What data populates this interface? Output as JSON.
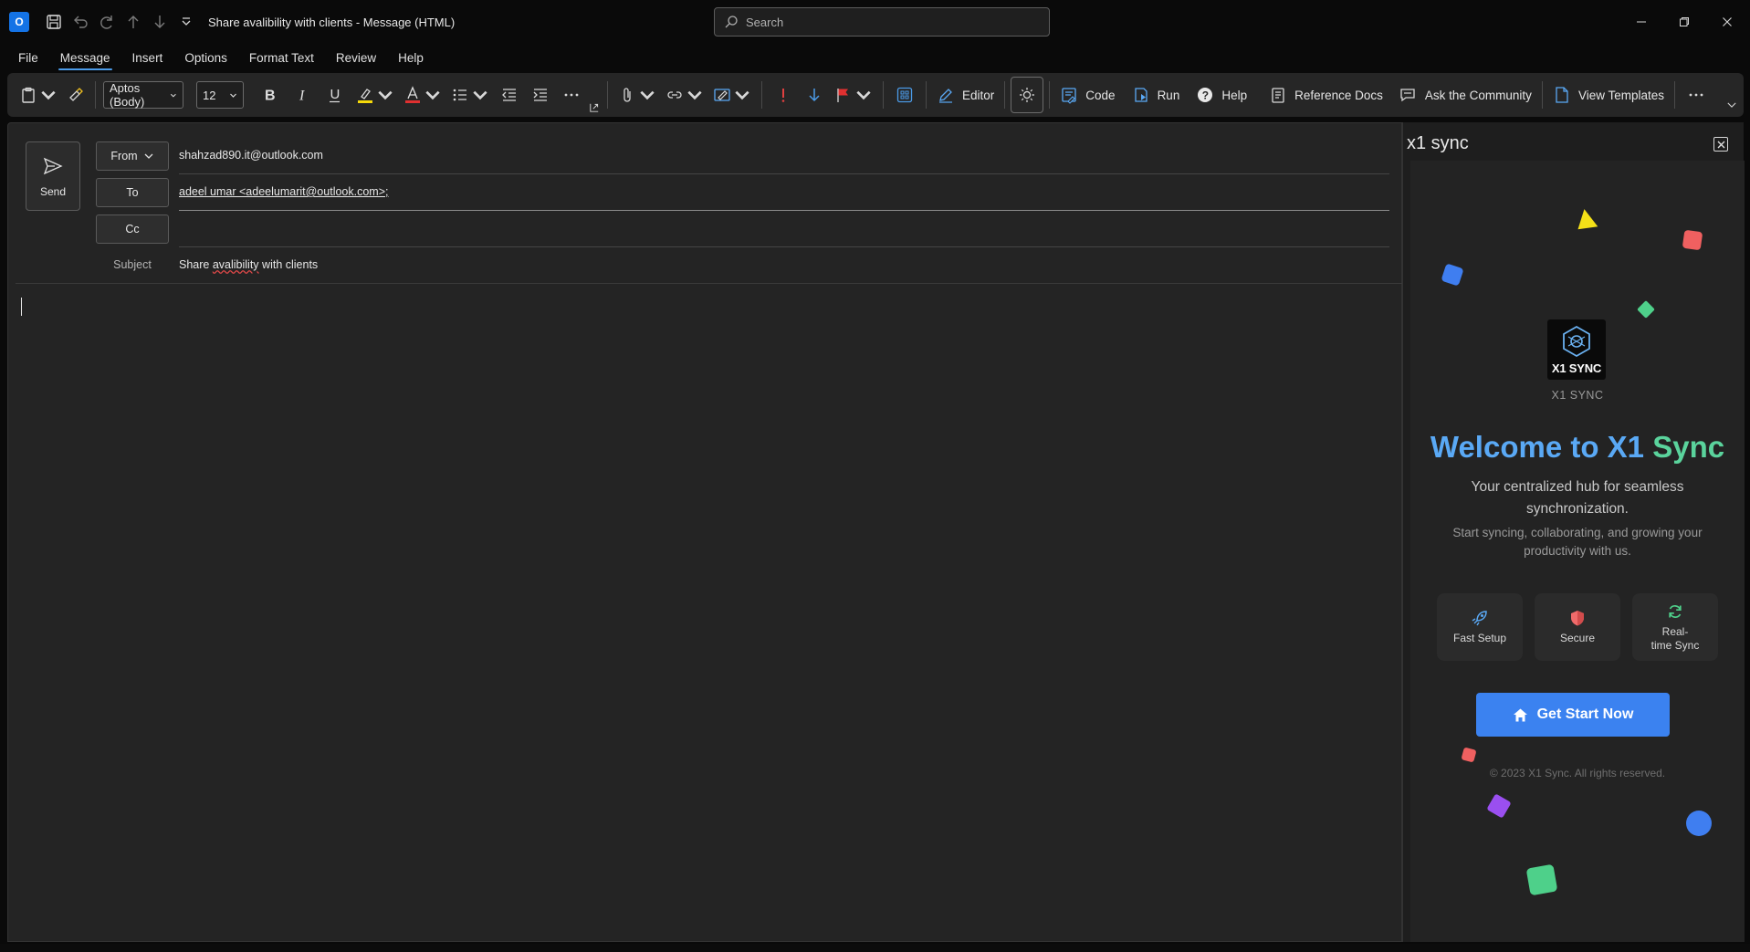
{
  "titlebar": {
    "app_icon": "outlook-icon",
    "window_title": "Share avalibility with clients  -  Message (HTML)",
    "search_placeholder": "Search"
  },
  "menu": {
    "tabs": [
      "File",
      "Message",
      "Insert",
      "Options",
      "Format Text",
      "Review",
      "Help"
    ],
    "active": "Message"
  },
  "ribbon": {
    "font_name": "Aptos (Body)",
    "font_size": "12",
    "editor_label": "Editor",
    "code_label": "Code",
    "run_label": "Run",
    "help_label": "Help",
    "reference_docs_label": "Reference Docs",
    "ask_community_label": "Ask the Community",
    "view_templates_label": "View Templates"
  },
  "compose": {
    "send_label": "Send",
    "from_label": "From",
    "from_value": "shahzad890.it@outlook.com",
    "to_label": "To",
    "to_value": "adeel umar <adeelumarit@outlook.com>;",
    "cc_label": "Cc",
    "cc_value": "",
    "subject_label": "Subject",
    "subject_value_pre": "Share ",
    "subject_value_misspelled": "avalibility",
    "subject_value_post": " with clients"
  },
  "pane": {
    "title": "x1 sync",
    "logo_text": "X1 SYNC",
    "brand_caption": "X1 SYNC",
    "welcome_part1": "Welcome to X1",
    "welcome_part2": "Sync",
    "tagline": "Your centralized hub for seamless synchronization.",
    "description": "Start syncing, collaborating, and growing your productivity with us.",
    "features": [
      {
        "label": "Fast Setup",
        "icon": "rocket-icon",
        "color": "#5aa9f5"
      },
      {
        "label": "Secure",
        "icon": "shield-icon",
        "color": "#f06b6b"
      },
      {
        "label": "Real-\ntime Sync",
        "icon": "sync-icon",
        "color": "#4fd18b"
      }
    ],
    "cta_label": "Get Start Now",
    "copyright": "© 2023 X1 Sync. All rights reserved."
  },
  "colors": {
    "accent_blue": "#3b82f0",
    "welcome_blue": "#5aa9f5",
    "welcome_green": "#5ad39c",
    "highlight_yellow": "#f5d90a",
    "font_red": "#e03030"
  }
}
